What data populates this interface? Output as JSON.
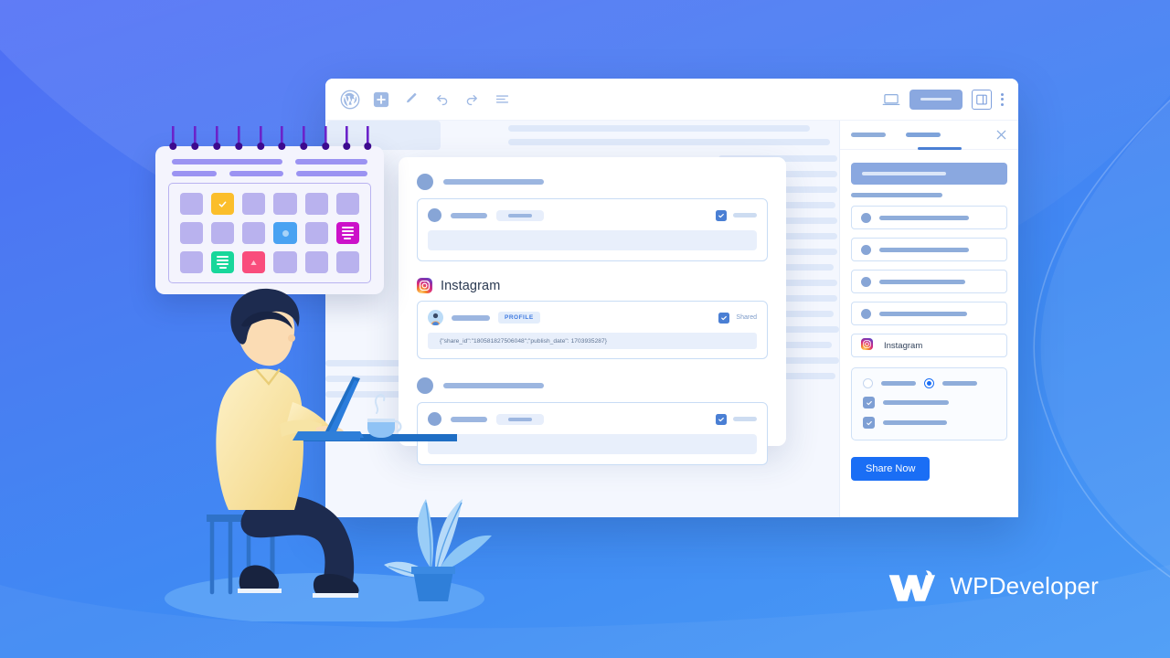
{
  "editor": {
    "toolbar": {
      "logo": "wordpress-logo",
      "add_block": "plus-icon",
      "edit_tool": "pencil-icon",
      "undo": "undo-icon",
      "redo": "redo-icon",
      "list_view": "list-view-icon",
      "device_preview": "laptop-icon",
      "preview_pill": "preview-button",
      "settings_panel": "sidebar-toggle-icon",
      "more_options": "kebab-menu-icon"
    }
  },
  "share_card": {
    "instagram": {
      "label": "Instagram",
      "profile_tag": "PROFILE",
      "shared_label": "Shared",
      "json_payload": "{\"share_id\":\"180581827506048\";\"publish_date\": 1703935287}"
    }
  },
  "sidebar": {
    "close_icon": "close-icon",
    "accounts": [
      {
        "name": ""
      },
      {
        "name": ""
      },
      {
        "name": ""
      },
      {
        "name": ""
      }
    ],
    "selected_account": {
      "name": "Instagram",
      "icon": "instagram-icon"
    },
    "share_button": "Share Now"
  },
  "calendar": {
    "highlight_days": [
      {
        "index": 1,
        "color": "#fbbe2b",
        "icon": "check-icon"
      },
      {
        "index": 9,
        "color": "#49a2f2",
        "icon": "circle-icon"
      },
      {
        "index": 11,
        "color": "#cc11c9",
        "icon": "lines-icon"
      },
      {
        "index": 13,
        "color": "#18d79b",
        "icon": "lines-icon"
      },
      {
        "index": 14,
        "color": "#f94d7c",
        "icon": "triangle-icon"
      }
    ]
  },
  "brand": {
    "name": "WPDeveloper",
    "logo": "wpdeveloper-w-logo"
  },
  "colors": {
    "background_top": "#4f6ef5",
    "background_bottom": "#4a9bf6",
    "accent_blue": "#1a6ef5",
    "muted_blue": "#8fadda",
    "panel_border": "#c8dcf5"
  }
}
